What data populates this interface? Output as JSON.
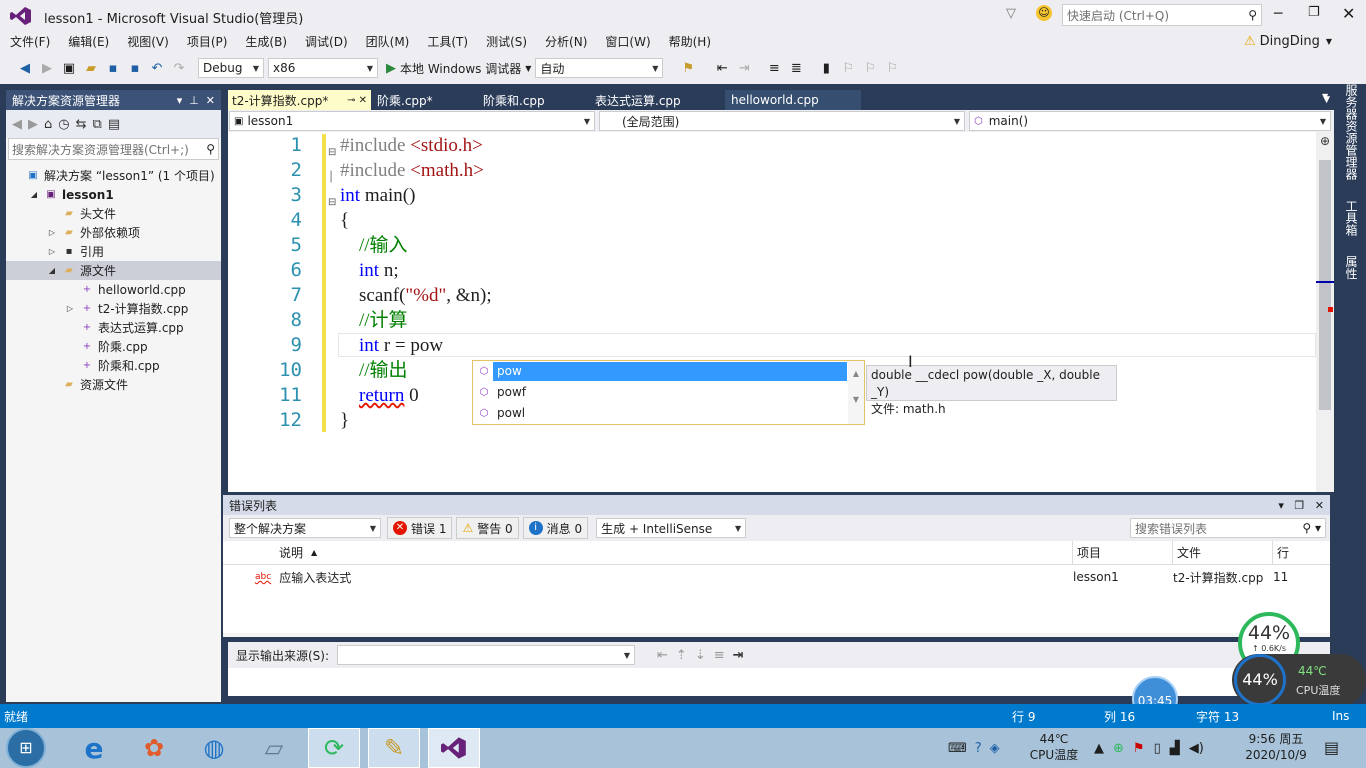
{
  "window": {
    "title": "lesson1 - Microsoft Visual Studio(管理员)",
    "quick_launch": "快速启动 (Ctrl+Q)",
    "user": "DingDing"
  },
  "menu": [
    "文件(F)",
    "编辑(E)",
    "视图(V)",
    "项目(P)",
    "生成(B)",
    "调试(D)",
    "团队(M)",
    "工具(T)",
    "测试(S)",
    "分析(N)",
    "窗口(W)",
    "帮助(H)"
  ],
  "toolbar": {
    "config": "Debug",
    "platform": "x86",
    "run_label": "本地 Windows 调试器",
    "mode": "自动"
  },
  "solution_explorer": {
    "title": "解决方案资源管理器",
    "search_placeholder": "搜索解决方案资源管理器(Ctrl+;)",
    "items": [
      {
        "label": "解决方案 “lesson1” (1 个项目)",
        "indent": 0,
        "tri": "",
        "icon": "solution"
      },
      {
        "label": "lesson1",
        "indent": 1,
        "tri": "◢",
        "icon": "project",
        "bold": true
      },
      {
        "label": "头文件",
        "indent": 2,
        "tri": "",
        "icon": "folder"
      },
      {
        "label": "外部依赖项",
        "indent": 2,
        "tri": "▷",
        "icon": "folder"
      },
      {
        "label": "引用",
        "indent": 2,
        "tri": "▷",
        "icon": "ref"
      },
      {
        "label": "源文件",
        "indent": 2,
        "tri": "◢",
        "icon": "folder",
        "selected": true
      },
      {
        "label": "helloworld.cpp",
        "indent": 3,
        "tri": "",
        "icon": "cpp"
      },
      {
        "label": "t2-计算指数.cpp",
        "indent": 3,
        "tri": "▷",
        "icon": "cpp"
      },
      {
        "label": "表达式运算.cpp",
        "indent": 3,
        "tri": "",
        "icon": "cpp"
      },
      {
        "label": "阶乘.cpp",
        "indent": 3,
        "tri": "",
        "icon": "cpp"
      },
      {
        "label": "阶乘和.cpp",
        "indent": 3,
        "tri": "",
        "icon": "cpp"
      },
      {
        "label": "资源文件",
        "indent": 2,
        "tri": "",
        "icon": "folder"
      }
    ]
  },
  "tabs": [
    "t2-计算指数.cpp*",
    "阶乘.cpp*",
    "阶乘和.cpp",
    "表达式运算.cpp",
    "helloworld.cpp"
  ],
  "nav": {
    "project": "lesson1",
    "scope": "(全局范围)",
    "member": "main()"
  },
  "code_lines": [
    [
      {
        "t": "#include ",
        "c": "pp"
      },
      {
        "t": "<stdio.h>",
        "c": "st"
      }
    ],
    [
      {
        "t": "#include ",
        "c": "pp"
      },
      {
        "t": "<math.h>",
        "c": "st"
      }
    ],
    [
      {
        "t": "int",
        "c": "kw"
      },
      {
        "t": " main()",
        "c": ""
      }
    ],
    [
      {
        "t": "{",
        "c": ""
      }
    ],
    [
      {
        "t": "    //输入",
        "c": "cm"
      }
    ],
    [
      {
        "t": "    ",
        "c": ""
      },
      {
        "t": "int",
        "c": "kw"
      },
      {
        "t": " n;",
        "c": ""
      }
    ],
    [
      {
        "t": "    scanf(",
        "c": ""
      },
      {
        "t": "\"%d\"",
        "c": "st"
      },
      {
        "t": ", &n);",
        "c": ""
      }
    ],
    [
      {
        "t": "    //计算",
        "c": "cm"
      }
    ],
    [
      {
        "t": "    ",
        "c": ""
      },
      {
        "t": "int",
        "c": "kw"
      },
      {
        "t": " r = pow",
        "c": ""
      }
    ],
    [
      {
        "t": "    //输出",
        "c": "cm"
      }
    ],
    [
      {
        "t": "    ",
        "c": ""
      },
      {
        "t": "return",
        "c": "kw"
      },
      {
        "t": " 0",
        "c": ""
      }
    ],
    [
      {
        "t": "}",
        "c": ""
      }
    ]
  ],
  "line_numbers": [
    "1",
    "2",
    "3",
    "4",
    "5",
    "6",
    "7",
    "8",
    "9",
    "10",
    "11",
    "12"
  ],
  "autocomplete": {
    "items": [
      "pow",
      "powf",
      "powl"
    ],
    "tooltip_sig": "double __cdecl pow(double _X, double _Y)",
    "tooltip_file": "文件: math.h"
  },
  "error_list": {
    "title": "错误列表",
    "scope": "整个解决方案",
    "errors": "错误 1",
    "warnings": "警告 0",
    "messages": "消息 0",
    "build": "生成 + IntelliSense",
    "search": "搜索错误列表",
    "headers": {
      "desc": "说明",
      "project": "项目",
      "file": "文件",
      "line": "行"
    },
    "rows": [
      {
        "desc": "应输入表达式",
        "project": "lesson1",
        "file": "t2-计算指数.cpp",
        "line": "11"
      }
    ]
  },
  "output": {
    "label": "显示输出来源(S):"
  },
  "right_rail": [
    "服务器资源管理器",
    "工具箱",
    "属性"
  ],
  "status": {
    "left": "就绪",
    "row": "行 9",
    "col": "列 16",
    "char": "字符 13",
    "ins": "Ins"
  },
  "widgets": {
    "mem_pct": "44%",
    "net": "↑ 0.6K/s",
    "cpu_pct": "44%",
    "cpu_temp": "44℃",
    "cpu_label": "CPU温度",
    "clock": "03:45"
  },
  "taskbar": {
    "temp": "44℃",
    "temp_label": "CPU温度",
    "time": "9:56 周五",
    "date": "2020/10/9"
  }
}
